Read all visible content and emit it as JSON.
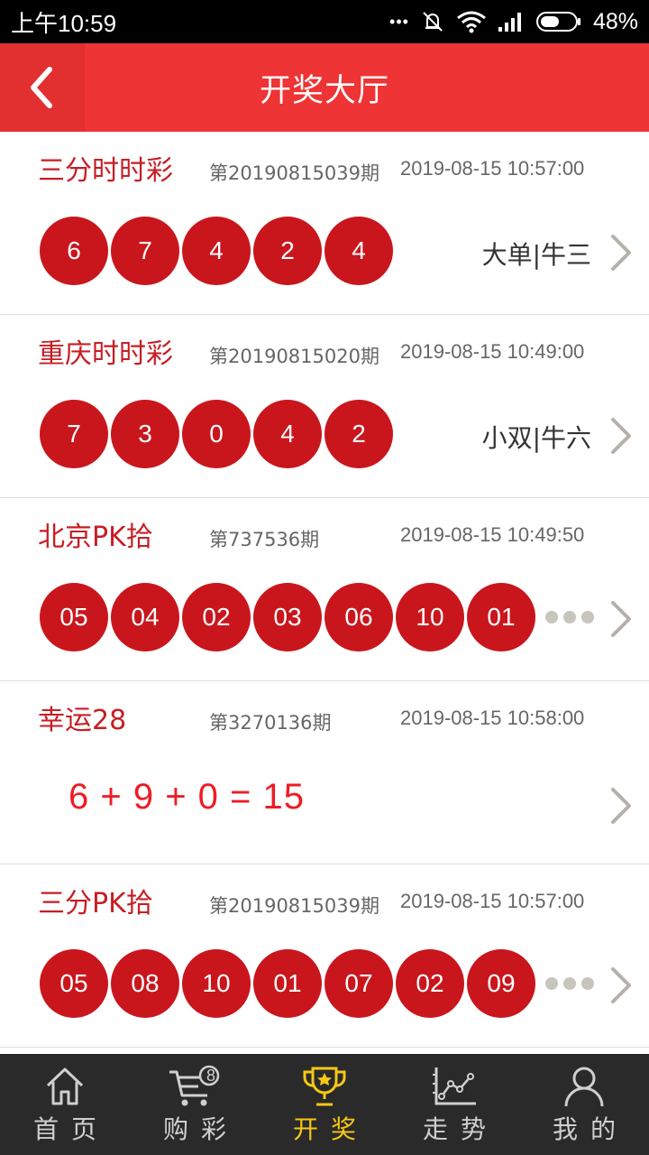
{
  "status_bar": {
    "time": "上午10:59",
    "battery": "48%",
    "more": "•••"
  },
  "header": {
    "title": "开奖大厅",
    "back_icon": "chevron-left-icon"
  },
  "lotteries": [
    {
      "name": "三分时时彩",
      "issue": "第20190815039期",
      "time": "2019-08-15 10:57:00",
      "balls": [
        "6",
        "7",
        "4",
        "2",
        "4"
      ],
      "summary": "大单|牛三",
      "more": false
    },
    {
      "name": "重庆时时彩",
      "issue": "第20190815020期",
      "time": "2019-08-15 10:49:00",
      "balls": [
        "7",
        "3",
        "0",
        "4",
        "2"
      ],
      "summary": "小双|牛六",
      "more": false
    },
    {
      "name": "北京PK拾",
      "issue": "第737536期",
      "time": "2019-08-15 10:49:50",
      "balls": [
        "05",
        "04",
        "02",
        "03",
        "06",
        "10",
        "01"
      ],
      "summary": "",
      "more": true
    },
    {
      "name": "幸运28",
      "issue": "第3270136期",
      "time": "2019-08-15 10:58:00",
      "equation": "6 + 9 + 0 = 15",
      "balls": [],
      "summary": "",
      "more": false
    },
    {
      "name": "三分PK拾",
      "issue": "第20190815039期",
      "time": "2019-08-15 10:57:00",
      "balls": [
        "05",
        "08",
        "10",
        "01",
        "07",
        "02",
        "09"
      ],
      "summary": "",
      "more": true
    }
  ],
  "tabbar": {
    "items": [
      {
        "label": "首页",
        "icon": "home-icon",
        "active": false
      },
      {
        "label": "购彩",
        "icon": "cart-icon",
        "badge": "8",
        "active": false
      },
      {
        "label": "开奖",
        "icon": "trophy-icon",
        "active": true
      },
      {
        "label": "走势",
        "icon": "trend-chart-icon",
        "active": false
      },
      {
        "label": "我的",
        "icon": "user-icon",
        "active": false
      }
    ]
  },
  "colors": {
    "header": "#ee3434",
    "ball": "#c9161d",
    "name": "#c71e24",
    "tab_active": "#f5c816",
    "tabbar": "#2a2a2a"
  }
}
